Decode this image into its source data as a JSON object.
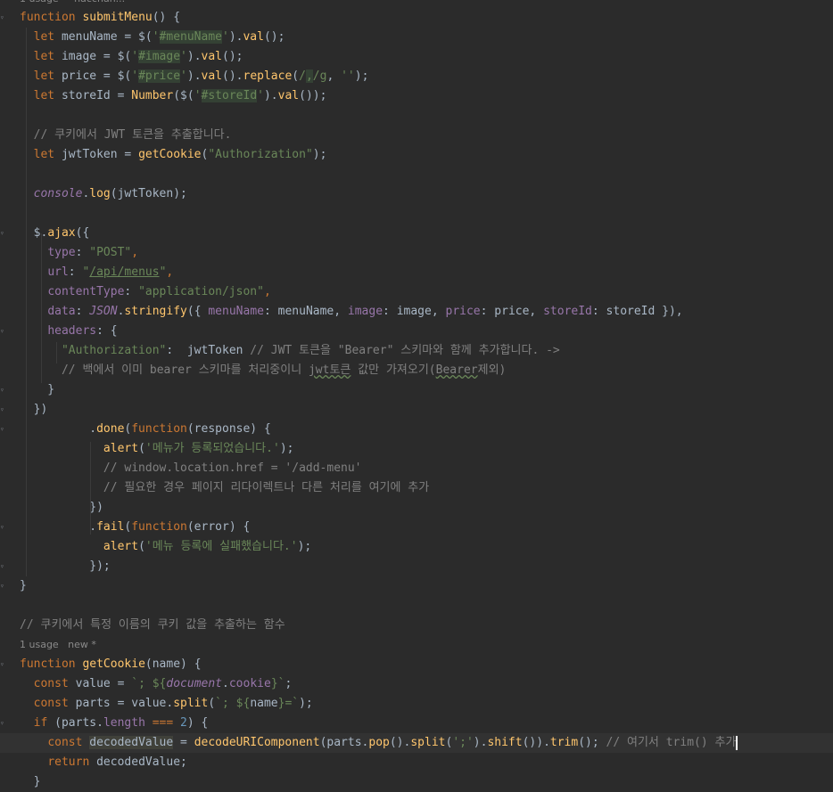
{
  "meta": {
    "top_hint": "1 usage  ·  hacchan...",
    "usage2": "1 usage   new *"
  },
  "lines": [
    {
      "segs": [
        [
          "kw",
          "function "
        ],
        [
          "fn",
          "submitMenu"
        ],
        [
          "",
          "() {"
        ]
      ]
    },
    {
      "segs": [
        [
          "",
          "  "
        ],
        [
          "kw",
          "let "
        ],
        [
          "",
          "menuName = $("
        ],
        [
          "str",
          "'"
        ],
        [
          "str hl",
          "#menuName"
        ],
        [
          "str",
          "'"
        ],
        [
          "",
          ")."
        ],
        [
          "fn",
          "val"
        ],
        [
          "",
          "();"
        ]
      ]
    },
    {
      "segs": [
        [
          "",
          "  "
        ],
        [
          "kw",
          "let "
        ],
        [
          "",
          "image = $("
        ],
        [
          "str",
          "'"
        ],
        [
          "str hl",
          "#image"
        ],
        [
          "str",
          "'"
        ],
        [
          "",
          ")."
        ],
        [
          "fn",
          "val"
        ],
        [
          "",
          "();"
        ]
      ]
    },
    {
      "segs": [
        [
          "",
          "  "
        ],
        [
          "kw",
          "let "
        ],
        [
          "",
          "price = $("
        ],
        [
          "str",
          "'"
        ],
        [
          "str hl",
          "#price"
        ],
        [
          "str",
          "'"
        ],
        [
          "",
          ")."
        ],
        [
          "fn",
          "val"
        ],
        [
          "",
          "()."
        ],
        [
          "fn",
          "replace"
        ],
        [
          "",
          "("
        ],
        [
          "str",
          "/"
        ],
        [
          "str hl",
          ","
        ],
        [
          "str",
          "/g"
        ],
        [
          "",
          ", "
        ],
        [
          "str",
          "''"
        ],
        [
          "",
          ");"
        ]
      ]
    },
    {
      "segs": [
        [
          "",
          "  "
        ],
        [
          "kw",
          "let "
        ],
        [
          "",
          "storeId = "
        ],
        [
          "fn",
          "Number"
        ],
        [
          "",
          "($("
        ],
        [
          "str",
          "'"
        ],
        [
          "str hl",
          "#storeId"
        ],
        [
          "str",
          "'"
        ],
        [
          "",
          ")."
        ],
        [
          "fn",
          "val"
        ],
        [
          "",
          "());"
        ]
      ]
    },
    {
      "segs": []
    },
    {
      "segs": [
        [
          "",
          "  "
        ],
        [
          "cm",
          "// 쿠키에서 JWT 토큰을 추출합니다."
        ]
      ]
    },
    {
      "segs": [
        [
          "",
          "  "
        ],
        [
          "kw",
          "let "
        ],
        [
          "",
          "jwtToken = "
        ],
        [
          "fn",
          "getCookie"
        ],
        [
          "",
          "("
        ],
        [
          "str",
          "\"Authorization\""
        ],
        [
          "",
          ");"
        ]
      ]
    },
    {
      "segs": []
    },
    {
      "segs": [
        [
          "",
          "  "
        ],
        [
          "glob",
          "console"
        ],
        [
          "",
          "."
        ],
        [
          "fn",
          "log"
        ],
        [
          "",
          "(jwtToken);"
        ]
      ]
    },
    {
      "segs": []
    },
    {
      "segs": [
        [
          "",
          "  "
        ],
        [
          "",
          "$."
        ],
        [
          "fn",
          "ajax"
        ],
        [
          "",
          "({"
        ]
      ]
    },
    {
      "segs": [
        [
          "",
          "    "
        ],
        [
          "prop",
          "type"
        ],
        [
          "",
          ": "
        ],
        [
          "str",
          "\"POST\""
        ],
        [
          "kw",
          ","
        ]
      ]
    },
    {
      "segs": [
        [
          "",
          "    "
        ],
        [
          "prop",
          "url"
        ],
        [
          "",
          ": "
        ],
        [
          "str",
          "\""
        ],
        [
          "str link",
          "/api/menus"
        ],
        [
          "str",
          "\""
        ],
        [
          "kw",
          ","
        ]
      ]
    },
    {
      "segs": [
        [
          "",
          "    "
        ],
        [
          "prop",
          "contentType"
        ],
        [
          "",
          ": "
        ],
        [
          "str",
          "\"application/json\""
        ],
        [
          "kw",
          ","
        ]
      ]
    },
    {
      "segs": [
        [
          "",
          "    "
        ],
        [
          "prop",
          "data"
        ],
        [
          "",
          ": "
        ],
        [
          "glob",
          "JSON"
        ],
        [
          "",
          "."
        ],
        [
          "fn",
          "stringify"
        ],
        [
          "",
          "({ "
        ],
        [
          "prop",
          "menuName"
        ],
        [
          "",
          ": menuName, "
        ],
        [
          "prop",
          "image"
        ],
        [
          "",
          ": image, "
        ],
        [
          "prop",
          "price"
        ],
        [
          "",
          ": price, "
        ],
        [
          "prop",
          "storeId"
        ],
        [
          "",
          ": storeId }),"
        ]
      ]
    },
    {
      "segs": [
        [
          "",
          "    "
        ],
        [
          "prop",
          "headers"
        ],
        [
          "",
          ": {"
        ]
      ]
    },
    {
      "segs": [
        [
          "",
          "      "
        ],
        [
          "str",
          "\"Authorization\""
        ],
        [
          "",
          ":  jwtToken "
        ],
        [
          "cm",
          "// JWT 토큰을 \"Bearer\" 스키마와 함께 추가합니다. ->"
        ]
      ]
    },
    {
      "segs": [
        [
          "",
          "      "
        ],
        [
          "cm",
          "// 백에서 이미 bearer 스키마를 처리중이니 "
        ],
        [
          "cm squig",
          "jwt토큰"
        ],
        [
          "cm",
          " 값만 가져오기("
        ],
        [
          "cm squig",
          "Bearer"
        ],
        [
          "cm",
          "제외)"
        ]
      ]
    },
    {
      "segs": [
        [
          "",
          "    }"
        ]
      ]
    },
    {
      "segs": [
        [
          "",
          "  })"
        ]
      ]
    },
    {
      "segs": [
        [
          "",
          "          ."
        ],
        [
          "fn",
          "done"
        ],
        [
          "",
          "("
        ],
        [
          "kw",
          "function"
        ],
        [
          "",
          "(response) {"
        ]
      ]
    },
    {
      "segs": [
        [
          "",
          "            "
        ],
        [
          "fn",
          "alert"
        ],
        [
          "",
          "("
        ],
        [
          "str",
          "'메뉴가 등록되었습니다.'"
        ],
        [
          "",
          ");"
        ]
      ]
    },
    {
      "segs": [
        [
          "",
          "            "
        ],
        [
          "cm",
          "// window.location.href = '/add-menu'"
        ]
      ]
    },
    {
      "segs": [
        [
          "",
          "            "
        ],
        [
          "cm",
          "// 필요한 경우 페이지 리다이렉트나 다른 처리를 여기에 추가"
        ]
      ]
    },
    {
      "segs": [
        [
          "",
          "          })"
        ]
      ]
    },
    {
      "segs": [
        [
          "",
          "          ."
        ],
        [
          "fn",
          "fail"
        ],
        [
          "",
          "("
        ],
        [
          "kw",
          "function"
        ],
        [
          "",
          "(error) {"
        ]
      ]
    },
    {
      "segs": [
        [
          "",
          "            "
        ],
        [
          "fn",
          "alert"
        ],
        [
          "",
          "("
        ],
        [
          "str",
          "'메뉴 등록에 실패했습니다.'"
        ],
        [
          "",
          ");"
        ]
      ]
    },
    {
      "segs": [
        [
          "",
          "          });"
        ]
      ]
    },
    {
      "segs": [
        [
          "",
          "}"
        ]
      ]
    },
    {
      "segs": []
    },
    {
      "segs": [
        [
          "cm",
          "// 쿠키에서 특정 이름의 쿠키 값을 추출하는 함수"
        ]
      ]
    },
    {
      "meta": "usage2"
    },
    {
      "segs": [
        [
          "kw",
          "function "
        ],
        [
          "fn",
          "getCookie"
        ],
        [
          "",
          "(name) {"
        ]
      ]
    },
    {
      "segs": [
        [
          "",
          "  "
        ],
        [
          "kw",
          "const "
        ],
        [
          "",
          "value = "
        ],
        [
          "str",
          "`; ${"
        ],
        [
          "glob",
          "document"
        ],
        [
          "",
          "."
        ],
        [
          "prop",
          "cookie"
        ],
        [
          "str",
          "}`"
        ],
        [
          "",
          ";"
        ]
      ]
    },
    {
      "segs": [
        [
          "",
          "  "
        ],
        [
          "kw",
          "const "
        ],
        [
          "",
          "parts = value."
        ],
        [
          "fn",
          "split"
        ],
        [
          "",
          "("
        ],
        [
          "str",
          "`; ${"
        ],
        [
          "",
          "name"
        ],
        [
          "str",
          "}=`"
        ],
        [
          "",
          ");"
        ]
      ]
    },
    {
      "segs": [
        [
          "",
          "  "
        ],
        [
          "kw",
          "if "
        ],
        [
          "",
          "(parts."
        ],
        [
          "prop",
          "length"
        ],
        [
          "",
          ""
        ],
        [
          "kw",
          " === "
        ],
        [
          "num",
          "2"
        ],
        [
          "",
          ") {"
        ]
      ]
    },
    {
      "current": true,
      "segs": [
        [
          "",
          "    "
        ],
        [
          "kw",
          "const "
        ],
        [
          "hlv",
          "decodedValue"
        ],
        [
          "",
          " = "
        ],
        [
          "fn",
          "decodeURIComponent"
        ],
        [
          "",
          "(parts."
        ],
        [
          "fn",
          "pop"
        ],
        [
          "",
          "()."
        ],
        [
          "fn",
          "split"
        ],
        [
          "",
          "("
        ],
        [
          "str",
          "';'"
        ],
        [
          "",
          ")."
        ],
        [
          "fn",
          "shift"
        ],
        [
          "",
          "())."
        ],
        [
          "fn",
          "trim"
        ],
        [
          "",
          "(); "
        ],
        [
          "cm",
          "// 여기서 trim() 추가"
        ]
      ]
    },
    {
      "segs": [
        [
          "",
          "    "
        ],
        [
          "kw",
          "return "
        ],
        [
          "",
          "decodedValue;"
        ]
      ]
    },
    {
      "segs": [
        [
          "",
          "  }"
        ]
      ]
    }
  ]
}
